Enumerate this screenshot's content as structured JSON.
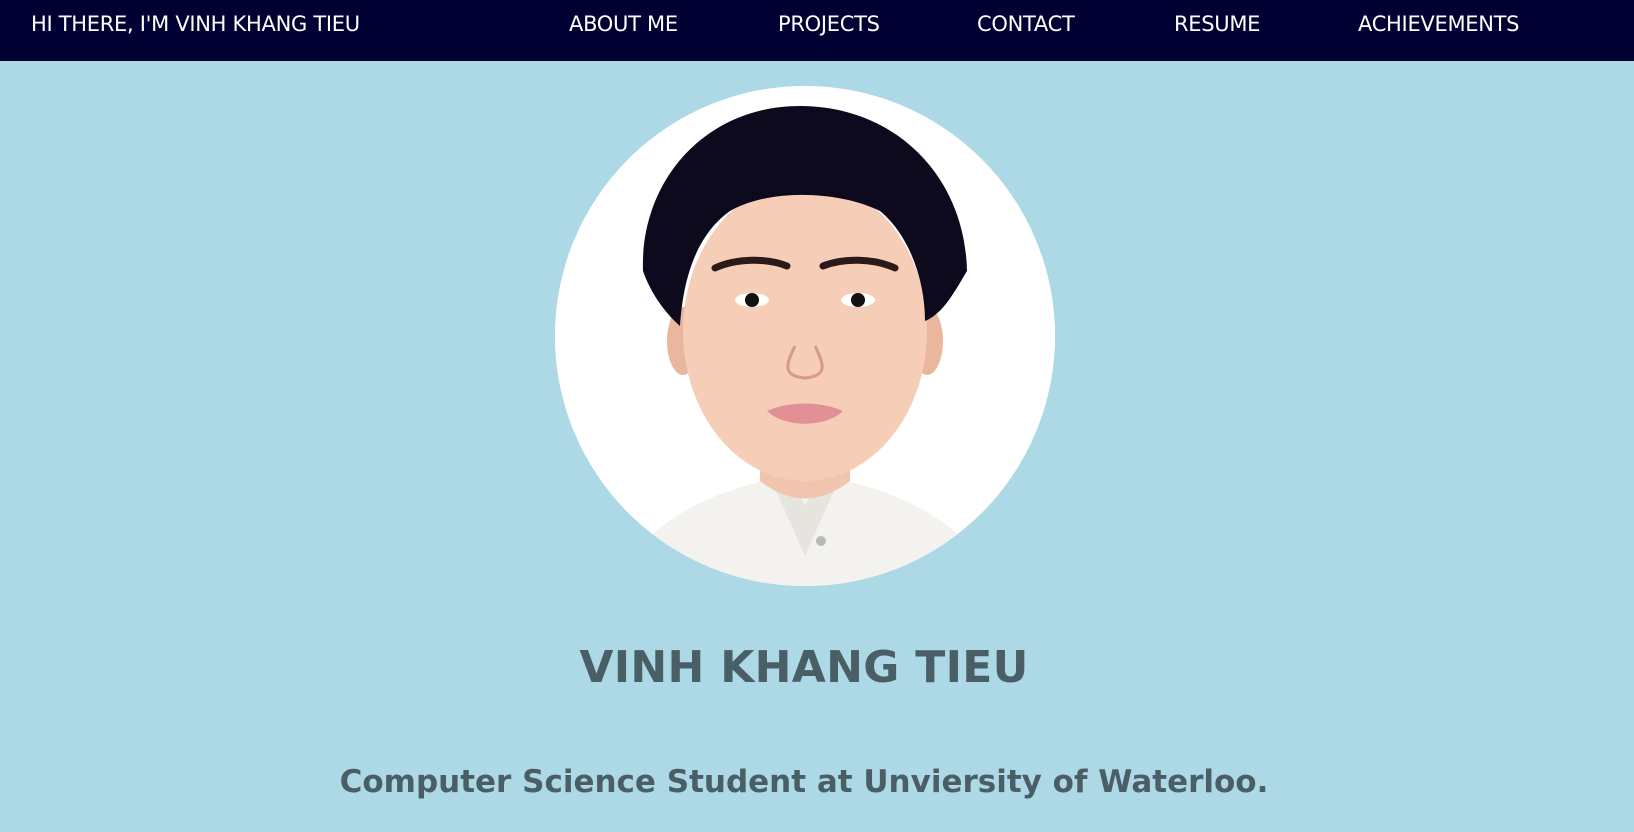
{
  "nav": {
    "brand": "HI THERE, I'M VINH KHANG TIEU",
    "links": [
      {
        "label": "ABOUT ME"
      },
      {
        "label": "PROJECTS"
      },
      {
        "label": "CONTACT"
      },
      {
        "label": "RESUME"
      },
      {
        "label": "ACHIEVEMENTS"
      }
    ]
  },
  "hero": {
    "name": "VINH KHANG TIEU",
    "tagline": "Computer Science Student at Unviersity of Waterloo."
  },
  "colors": {
    "page_background": "#add8e6",
    "navbar_background": "#000033",
    "nav_text": "#ffffff",
    "heading_text": "#4a5e66"
  }
}
